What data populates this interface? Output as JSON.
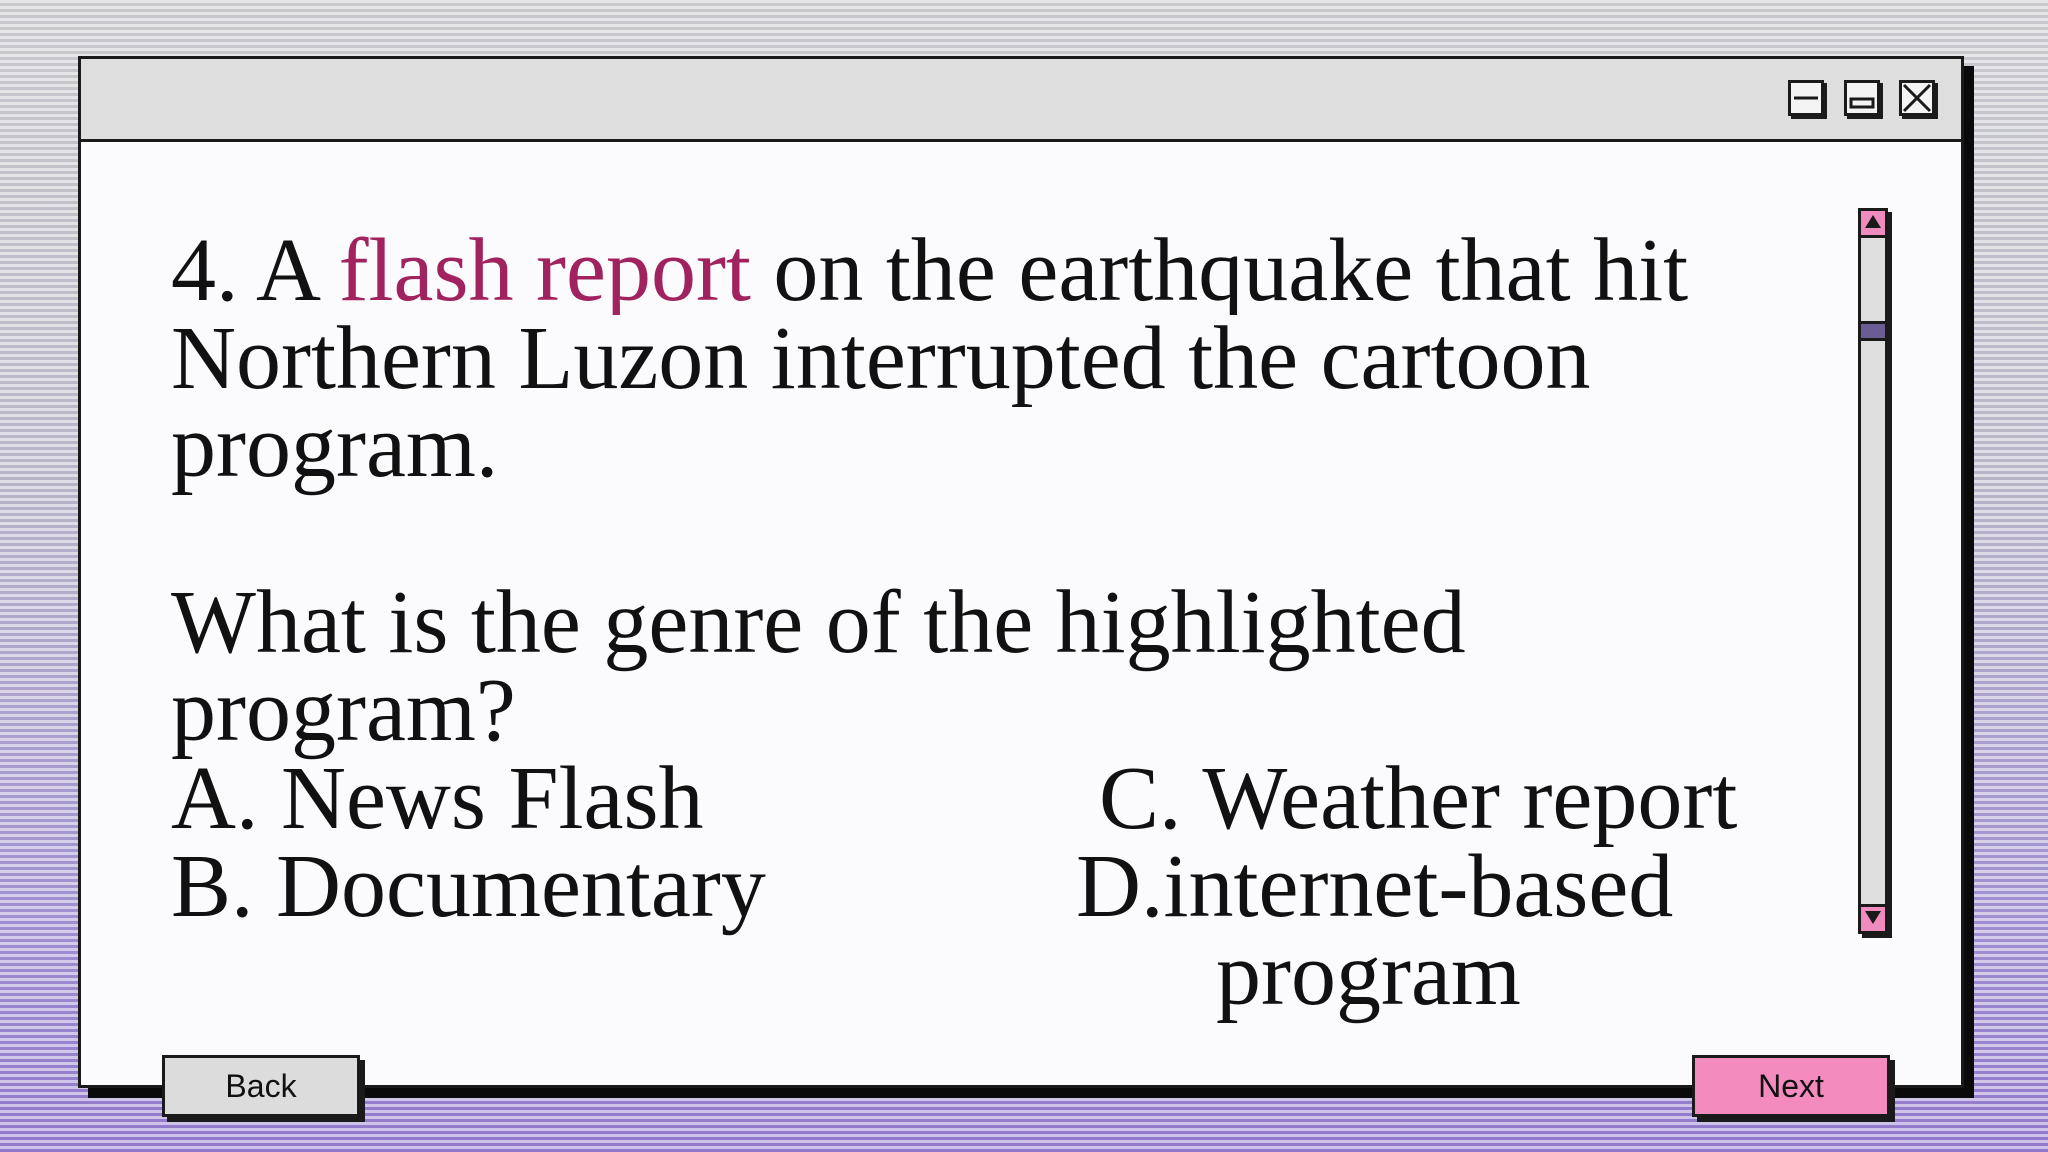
{
  "window": {
    "controls": {
      "minimize_icon": "minimize-icon",
      "maximize_icon": "maximize-icon",
      "close_icon": "close-icon"
    }
  },
  "question": {
    "number_prefix": "4. A ",
    "highlight": "flash report",
    "line1_rest": " on the earthquake that hit",
    "line2": "Northern Luzon interrupted the cartoon",
    "line3": "program.",
    "prompt_line1": "What is the genre of the highlighted",
    "prompt_line2": "program?"
  },
  "choices": {
    "a": "A. News Flash",
    "b": "B. Documentary",
    "c": "C. Weather report",
    "d_line1": "D.internet-based",
    "d_line2": "program"
  },
  "buttons": {
    "back": "Back",
    "next": "Next"
  },
  "colors": {
    "highlight": "#a0225e",
    "next_button": "#f38bbe",
    "scroll_arrow": "#f08bbd",
    "scroll_thumb": "#6a5d94"
  }
}
